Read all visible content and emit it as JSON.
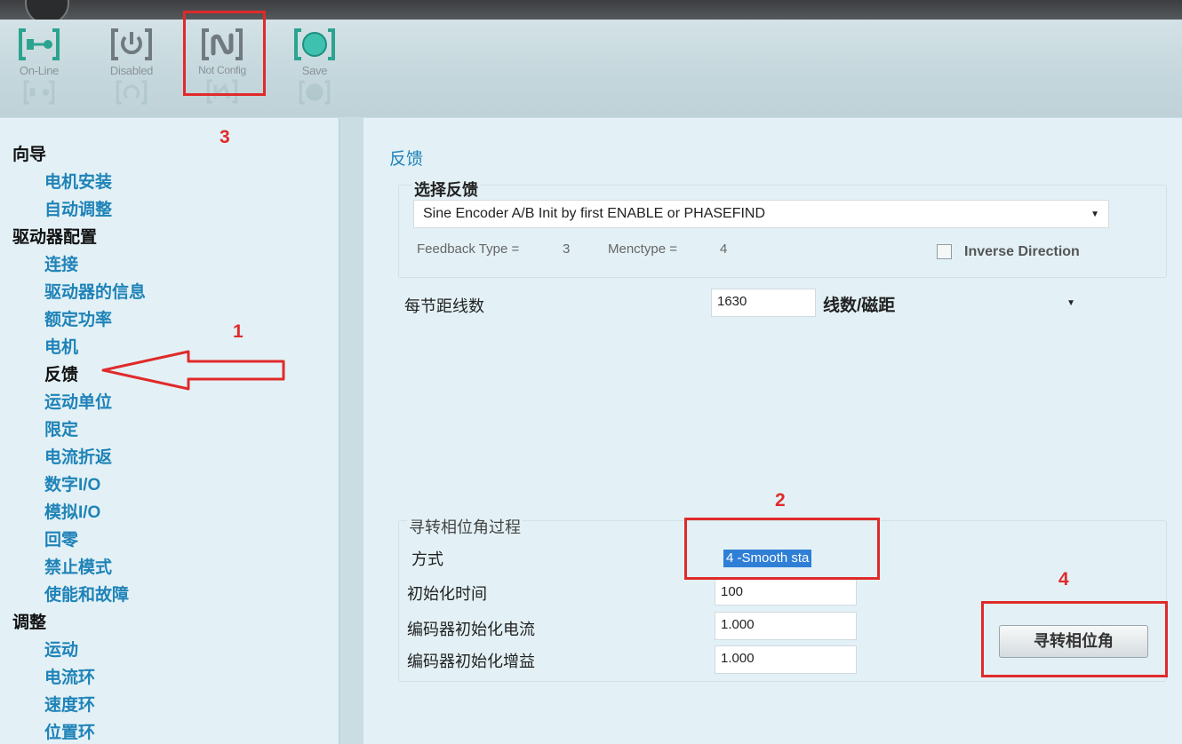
{
  "toolbar": {
    "items": [
      {
        "label": "On-Line",
        "icon": "online-icon",
        "color": "#2ba38f"
      },
      {
        "label": "Disabled",
        "icon": "power-icon",
        "color": "#707a80"
      },
      {
        "label": "Not Config",
        "icon": "not-config-icon",
        "color": "#707a80"
      },
      {
        "label": "Save",
        "icon": "save-icon",
        "color": "#2ba38f"
      }
    ]
  },
  "nav": {
    "items": [
      {
        "label": "向导",
        "level": "category"
      },
      {
        "label": "电机安装",
        "level": "sub"
      },
      {
        "label": "自动调整",
        "level": "sub"
      },
      {
        "label": "驱动器配置",
        "level": "category"
      },
      {
        "label": "连接",
        "level": "sub"
      },
      {
        "label": "驱动器的信息",
        "level": "sub"
      },
      {
        "label": "额定功率",
        "level": "sub"
      },
      {
        "label": "电机",
        "level": "sub"
      },
      {
        "label": "反馈",
        "level": "sub",
        "active": true
      },
      {
        "label": "运动单位",
        "level": "sub"
      },
      {
        "label": "限定",
        "level": "sub"
      },
      {
        "label": "电流折返",
        "level": "sub"
      },
      {
        "label": "数字I/O",
        "level": "sub"
      },
      {
        "label": "模拟I/O",
        "level": "sub"
      },
      {
        "label": "回零",
        "level": "sub"
      },
      {
        "label": "禁止模式",
        "level": "sub"
      },
      {
        "label": "使能和故障",
        "level": "sub"
      },
      {
        "label": "调整",
        "level": "category"
      },
      {
        "label": "运动",
        "level": "sub"
      },
      {
        "label": "电流环",
        "level": "sub"
      },
      {
        "label": "速度环",
        "level": "sub"
      },
      {
        "label": "位置环",
        "level": "sub"
      }
    ]
  },
  "content": {
    "title": "反馈",
    "select_feedback": {
      "label": "选择反馈",
      "value": "Sine Encoder A/B Init by first ENABLE or PHASEFIND",
      "feedback_type_label": "Feedback Type =",
      "feedback_type_value": "3",
      "menctype_label": "Menctype =",
      "menctype_value": "4",
      "inverse_direction_label": "Inverse Direction",
      "inverse_direction_checked": false
    },
    "lines_per_pitch": {
      "label": "每节距线数",
      "value": "1630",
      "unit": "线数/磁距"
    },
    "phase_find": {
      "group_label": "寻转相位角过程",
      "method_label": "方式",
      "method_value": "4 -Smooth sta",
      "init_time_label": "初始化时间",
      "init_time_value": "100",
      "init_current_label": "编码器初始化电流",
      "init_current_value": "1.000",
      "init_gain_label": "编码器初始化增益",
      "init_gain_value": "1.000",
      "button_label": "寻转相位角"
    }
  },
  "annotations": {
    "color": "#e02a2a",
    "labels": [
      "1",
      "2",
      "3",
      "4"
    ]
  }
}
